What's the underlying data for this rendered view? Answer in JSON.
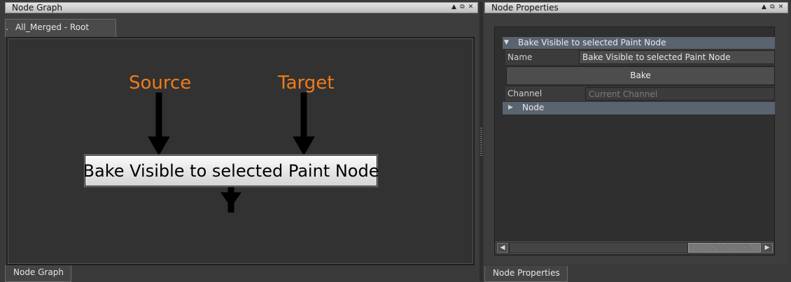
{
  "node_graph": {
    "title": "Node Graph",
    "tab_label": "All_Merged - Root",
    "tab_prefix": ".",
    "bottom_tab": "Node Graph",
    "annotations": {
      "source": "Source",
      "target": "Target"
    },
    "node_label": "Bake Visible to selected Paint Node",
    "accent": "#f07b19"
  },
  "node_properties": {
    "title": "Node Properties",
    "bottom_tab": "Node Properties",
    "section_title": "Bake Visible to selected Paint Node",
    "name_label": "Name",
    "name_value": "Bake Visible to selected Paint Node",
    "bake_button": "Bake",
    "channel_label": "Channel",
    "channel_placeholder": "Current Channel",
    "node_group": "Node"
  },
  "window_buttons": {
    "pin": "▲",
    "float": "⧉",
    "close": "✕"
  }
}
